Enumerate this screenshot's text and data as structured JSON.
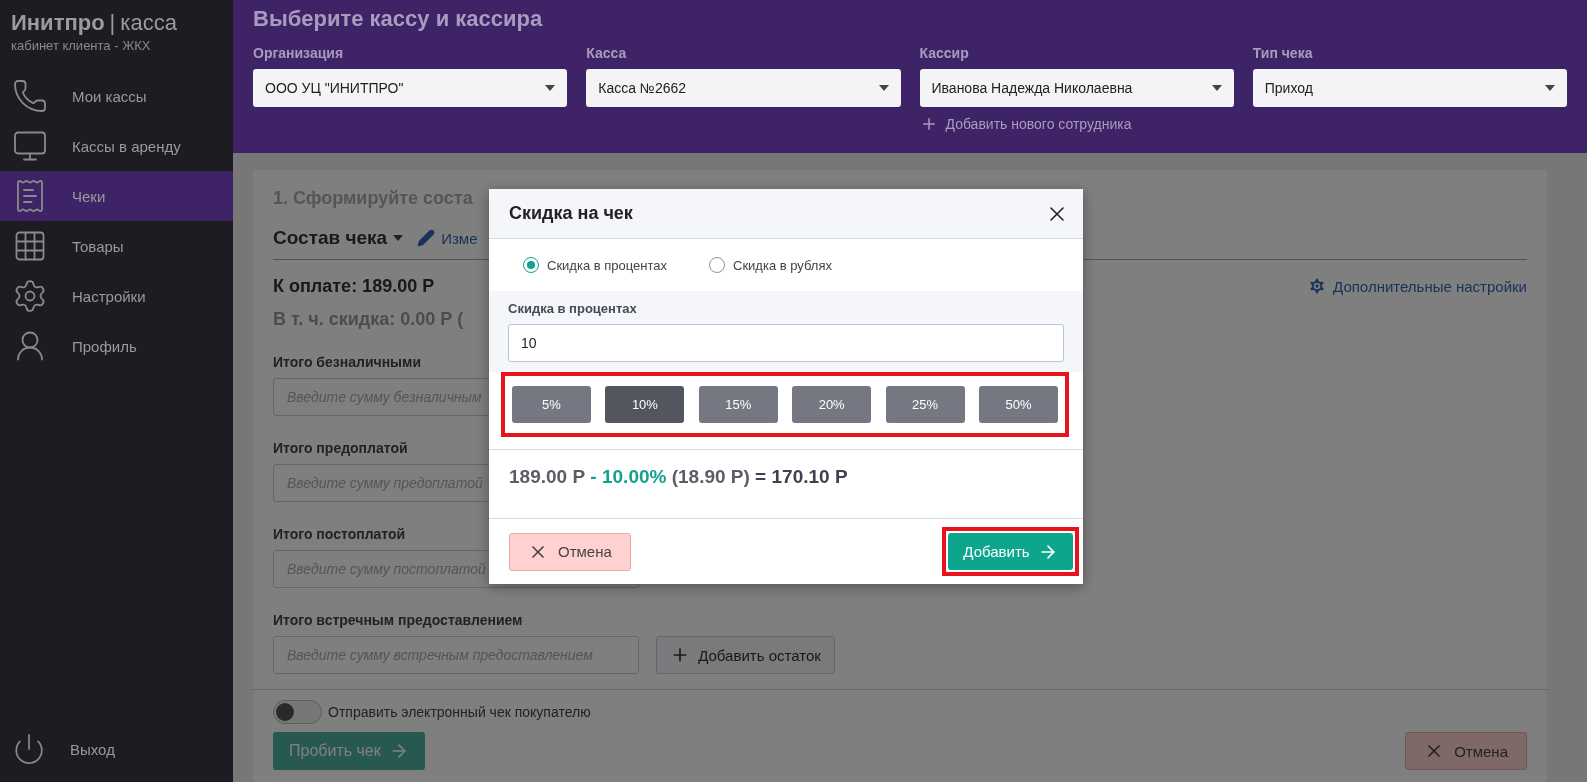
{
  "sidebar": {
    "logo_main": "Инитпро",
    "logo_sep": "|",
    "logo_sub": "касса",
    "subtitle": "кабинет клиента - ЖКХ",
    "items": [
      {
        "label": "Мои кассы",
        "selected": false
      },
      {
        "label": "Кассы в аренду",
        "selected": false
      },
      {
        "label": "Чеки",
        "selected": true
      },
      {
        "label": "Товары",
        "selected": false
      },
      {
        "label": "Настройки",
        "selected": false
      },
      {
        "label": "Профиль",
        "selected": false
      }
    ],
    "logout": "Выход"
  },
  "header": {
    "title": "Выберите кассу и кассира",
    "fields": [
      {
        "label": "Организация",
        "value": "ООО УЦ \"ИНИТПРО\""
      },
      {
        "label": "Касса",
        "value": "Касса №2662"
      },
      {
        "label": "Кассир",
        "value": "Иванова  Надежда Николаевна"
      },
      {
        "label": "Тип чека",
        "value": "Приход"
      }
    ],
    "add_employee": "Добавить нового сотрудника"
  },
  "card": {
    "step_title": "1. Сформируйте соста",
    "composition": "Состав чека",
    "edit_link": "Изме",
    "to_pay": "К оплате: 189.00 Р",
    "discount_line": "В т. ч. скидка: 0.00 Р (",
    "settings_link": "Дополнительные настройки",
    "payments": [
      {
        "label": "Итого безналичными",
        "placeholder": "Введите сумму безналичным"
      },
      {
        "label": "Итого предоплатой",
        "placeholder": "Введите сумму предоплатой"
      },
      {
        "label": "Итого постоплатой",
        "placeholder": "Введите сумму постоплатой"
      },
      {
        "label": "Итого встречным предоставлением",
        "placeholder": "Введите сумму встречным предоставлением",
        "button": "Добавить остаток"
      }
    ]
  },
  "footer": {
    "send_receipt": {
      "label": "Отправить электронный чек покупателю",
      "on": false
    },
    "submit": "Пробить чек",
    "cancel": "Отмена"
  },
  "modal": {
    "title": "Скидка на чек",
    "modes": [
      {
        "label": "Скидка в процентах",
        "selected": true
      },
      {
        "label": "Скидка в рублях",
        "selected": false
      }
    ],
    "field_label": "Скидка в процентах",
    "value": "10",
    "presets": {
      "highlighted": true,
      "items": [
        {
          "label": "5%",
          "selected": false
        },
        {
          "label": "10%",
          "selected": true
        },
        {
          "label": "15%",
          "selected": false
        },
        {
          "label": "20%",
          "selected": false
        },
        {
          "label": "25%",
          "selected": false
        },
        {
          "label": "50%",
          "selected": false
        }
      ]
    },
    "result": [
      {
        "text": "189.00 Р",
        "kind": "base"
      },
      {
        "text": "- 10.00%",
        "kind": "percent"
      },
      {
        "text": "(18.90 Р)",
        "kind": "amount"
      },
      {
        "text": "= 170.10 Р",
        "kind": "total"
      }
    ],
    "cancel": "Отмена",
    "add": {
      "label": "Добавить",
      "highlighted": true
    }
  }
}
